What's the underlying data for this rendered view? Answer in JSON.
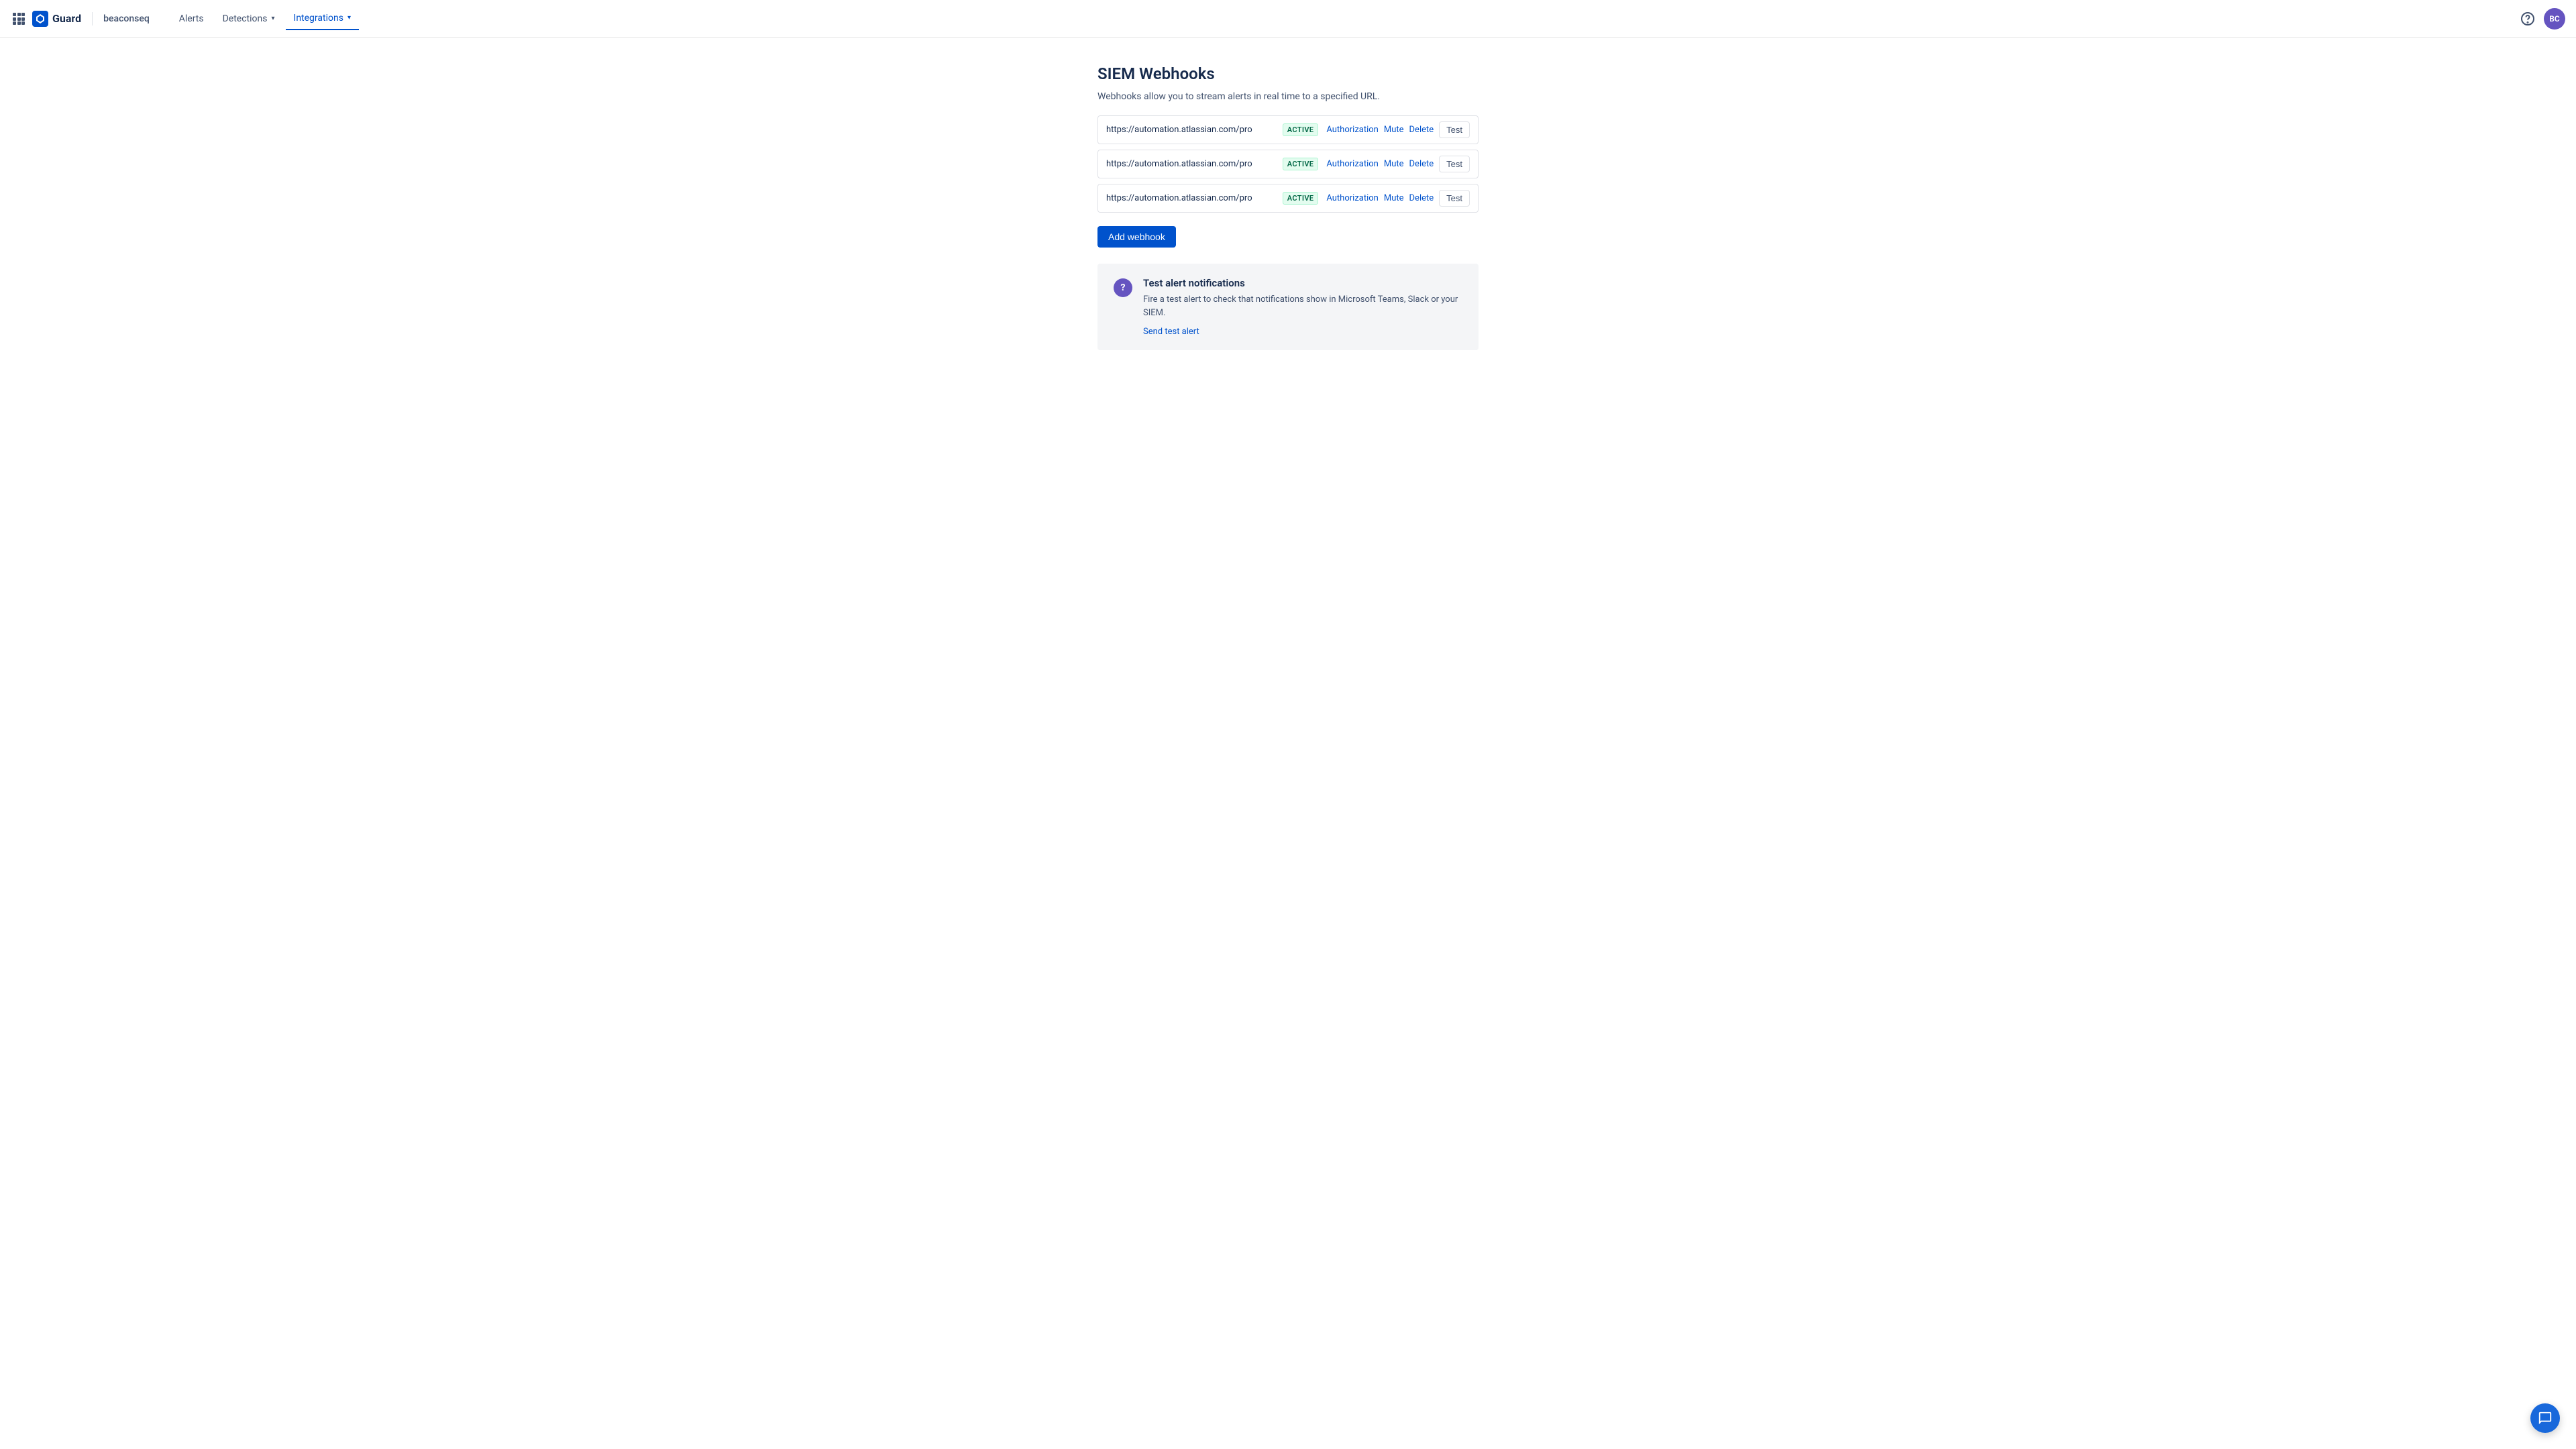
{
  "navbar": {
    "apps_icon_label": "apps",
    "brand": "Guard",
    "workspace": "beaconseq",
    "nav_links": [
      {
        "label": "Alerts",
        "active": false
      },
      {
        "label": "Detections",
        "active": false,
        "has_chevron": true
      },
      {
        "label": "Integrations",
        "active": true,
        "has_chevron": true
      }
    ],
    "help_title": "Help",
    "avatar_initials": "BC"
  },
  "page": {
    "title": "SIEM Webhooks",
    "description": "Webhooks allow you to stream alerts in real time to a specified URL.",
    "webhooks": [
      {
        "url": "https://automation.atlassian.com/pro",
        "status": "ACTIVE",
        "authorization_label": "Authorization",
        "mute_label": "Mute",
        "delete_label": "Delete",
        "test_label": "Test"
      },
      {
        "url": "https://automation.atlassian.com/pro",
        "status": "ACTIVE",
        "authorization_label": "Authorization",
        "mute_label": "Mute",
        "delete_label": "Delete",
        "test_label": "Test"
      },
      {
        "url": "https://automation.atlassian.com/pro",
        "status": "ACTIVE",
        "authorization_label": "Authorization",
        "mute_label": "Mute",
        "delete_label": "Delete",
        "test_label": "Test"
      }
    ],
    "add_webhook_label": "Add webhook",
    "test_alert": {
      "icon": "?",
      "title": "Test alert notifications",
      "description": "Fire a test alert to check that notifications show in Microsoft Teams, Slack or your SIEM.",
      "link_label": "Send test alert"
    }
  }
}
